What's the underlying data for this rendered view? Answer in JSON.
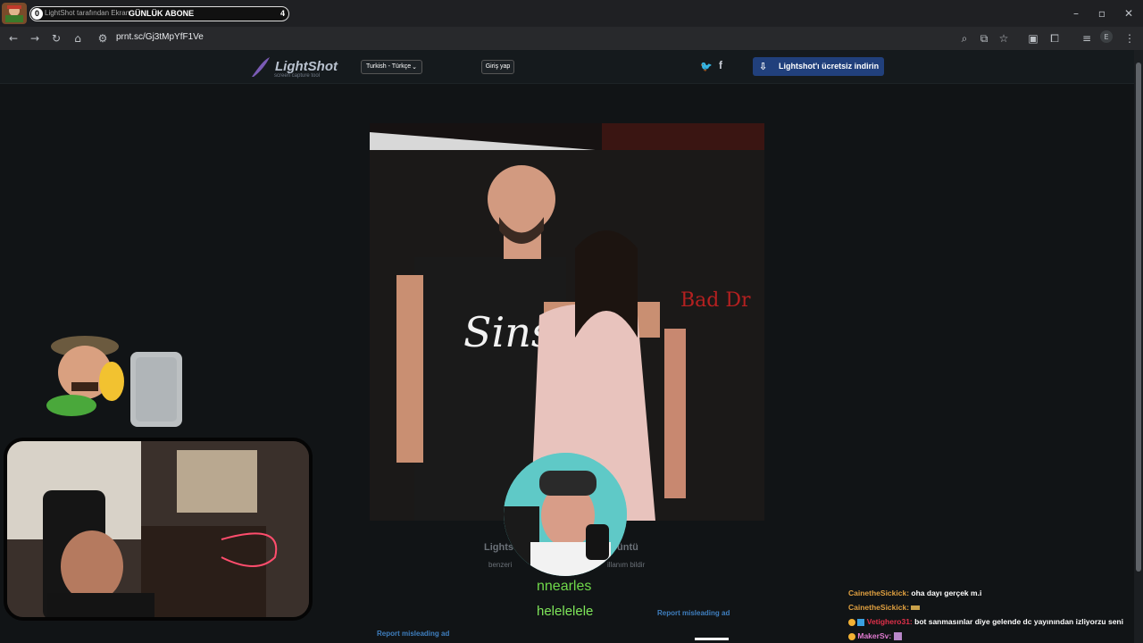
{
  "browser": {
    "url": "prnt.sc/Gj3tMpYfF1Ve",
    "profile_initial": "E"
  },
  "overlay": {
    "sub_count": "0",
    "tab_title_behind": "LightShot tarafından Ekran",
    "sub_label": "GÜNLÜK ABONE",
    "sub_goal": "4"
  },
  "lightshot": {
    "logo": "LightShot",
    "logo_sub": "screen capture tool",
    "language": "Turkish - Türkçe",
    "login": "Giriş yap",
    "download": "Lightshot'ı ücretsiz indirin",
    "caption_left": "Lights",
    "caption_right": "örüntü",
    "similar_left": "benzeri",
    "similar_right": "illanım bildir",
    "report_ad_left": "Report misleading ad",
    "report_ad_right": "Report misleading ad",
    "image_sign": "Bad Dr",
    "shirt_text": "Sins"
  },
  "stream": {
    "name_text": "nnearles",
    "hele_text": "helelelele"
  },
  "chat": [
    {
      "user": "CainetheSickick:",
      "msg": "oha dayı gerçek m.i",
      "color": "#e0a040"
    },
    {
      "user": "CainetheSickick:",
      "msg": "",
      "color": "#e0a040"
    },
    {
      "user": "Vetighero31:",
      "msg": "bot sanmasınlar diye gelende dc yayınından izliyorzu seni",
      "color": "#e0304a"
    },
    {
      "user": "MakerSv:",
      "msg": "",
      "color": "#e07ad0"
    }
  ],
  "colors": {
    "accent_blue": "#21407c",
    "link_blue": "#3f7fbf",
    "chat_green": "#6fd84a"
  }
}
